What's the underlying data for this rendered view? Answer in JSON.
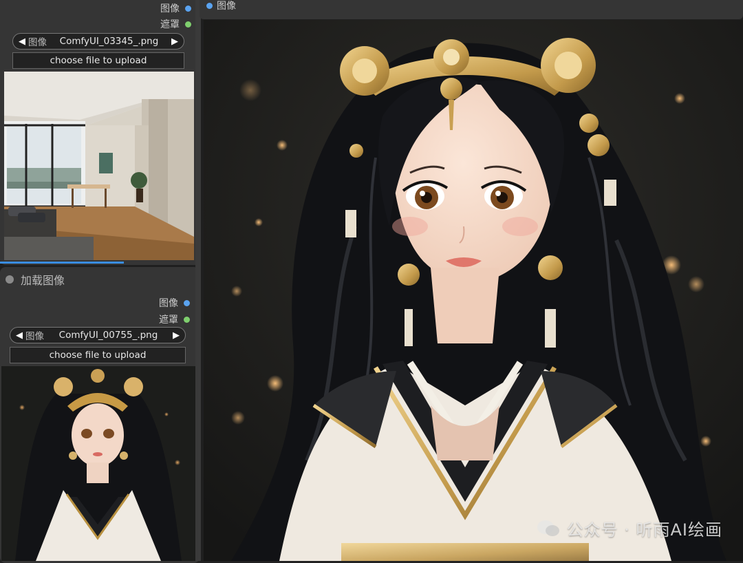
{
  "node_top": {
    "outputs": [
      {
        "label": "图像",
        "color": "#5aa3f0"
      },
      {
        "label": "遮罩",
        "color": "#7fcf6e"
      }
    ],
    "image_widget": {
      "label": "图像",
      "value": "ComfyUI_03345_.png"
    },
    "upload_label": "choose file to upload",
    "thumbnail": "interior-room-photo"
  },
  "node_bottom": {
    "title": "加载图像",
    "outputs": [
      {
        "label": "图像",
        "color": "#5aa3f0"
      },
      {
        "label": "遮罩",
        "color": "#7fcf6e"
      }
    ],
    "image_widget": {
      "label": "图像",
      "value": "ComfyUI_00755_.png"
    },
    "upload_label": "choose file to upload",
    "thumbnail": "hanfu-girl-portrait"
  },
  "preview": {
    "label": "图像",
    "watermark": "公众号 · 听雨AI绘画",
    "image": "hanfu-girl-portrait-large"
  },
  "icons": {
    "prev": "◀",
    "next": "▶"
  }
}
